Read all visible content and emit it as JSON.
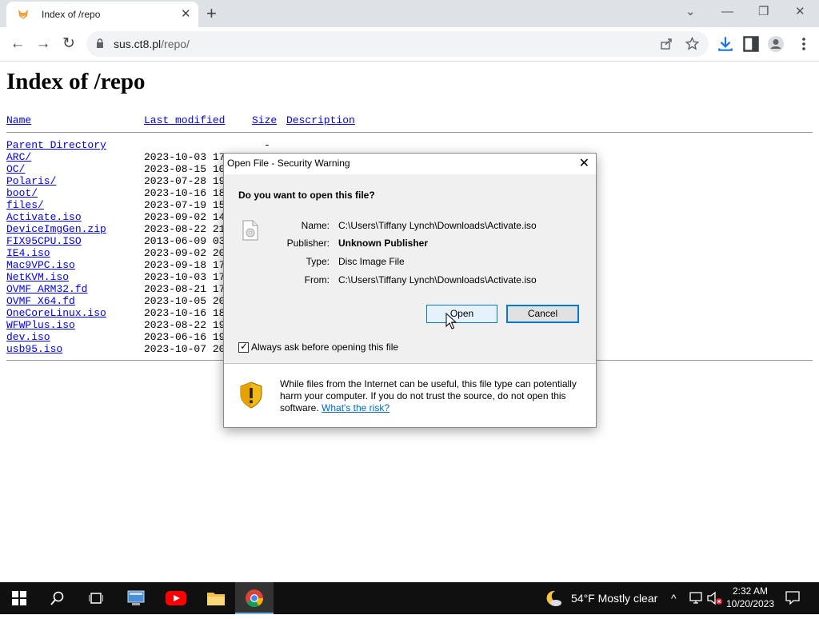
{
  "browser": {
    "tab_title": "Index of /repo",
    "tab_close": "✕",
    "new_tab": "+",
    "url_host": "sus.ct8.pl",
    "url_path": "/repo/",
    "win_dropdown": "⌄",
    "win_minimize": "—",
    "win_restore": "❐",
    "win_close": "✕",
    "back": "←",
    "forward": "→",
    "reload": "↻"
  },
  "page": {
    "heading": "Index of /repo",
    "headers": {
      "name": "Name",
      "last_modified": "Last modified",
      "size": "Size",
      "description": "Description"
    },
    "rows": [
      {
        "name": "Parent Directory",
        "date": "",
        "size": "-"
      },
      {
        "name": "ARC/",
        "date": "2023-10-03 17:"
      },
      {
        "name": "OC/",
        "date": "2023-08-15 10:"
      },
      {
        "name": "Polaris/",
        "date": "2023-07-28 19:"
      },
      {
        "name": "boot/",
        "date": "2023-10-16 18:"
      },
      {
        "name": "files/",
        "date": "2023-07-19 15:"
      },
      {
        "name": "Activate.iso",
        "date": "2023-09-02 14:"
      },
      {
        "name": "DeviceImgGen.zip",
        "date": "2023-08-22 21:"
      },
      {
        "name": "FIX95CPU.ISO",
        "date": "2013-06-09 03:"
      },
      {
        "name": "IE4.iso",
        "date": "2023-09-02 20:"
      },
      {
        "name": "Mac9VPC.iso",
        "date": "2023-09-18 17:"
      },
      {
        "name": "NetKVM.iso",
        "date": "2023-10-03 17:"
      },
      {
        "name": "OVMF_ARM32.fd",
        "date": "2023-08-21 17:"
      },
      {
        "name": "OVMF_X64.fd",
        "date": "2023-10-05 20:"
      },
      {
        "name": "OneCoreLinux.iso",
        "date": "2023-10-16 18:"
      },
      {
        "name": "WFWPlus.iso",
        "date": "2023-08-22 19:"
      },
      {
        "name": "dev.iso",
        "date": "2023-06-16 19:"
      },
      {
        "name": "usb95.iso",
        "date": "2023-10-07 20:"
      }
    ]
  },
  "dialog": {
    "title": "Open File - Security Warning",
    "close": "✕",
    "question": "Do you want to open this file?",
    "name_label": "Name:",
    "name_value": "C:\\Users\\Tiffany Lynch\\Downloads\\Activate.iso",
    "publisher_label": "Publisher:",
    "publisher_value": "Unknown Publisher",
    "type_label": "Type:",
    "type_value": "Disc Image File",
    "from_label": "From:",
    "from_value": "C:\\Users\\Tiffany Lynch\\Downloads\\Activate.iso",
    "open_button": "Open",
    "cancel_button": "Cancel",
    "checkbox_label": "Always ask before opening this file",
    "checkbox_mark": "✓",
    "warning_text": "While files from the Internet can be useful, this file type can potentially harm your computer. If you do not trust the source, do not open this software.",
    "warning_link": "What's the risk?"
  },
  "taskbar": {
    "weather": "54°F  Mostly clear",
    "time": "2:32 AM",
    "date": "10/20/2023",
    "chevron": "^"
  },
  "colors": {
    "link": "#0000ee",
    "accent": "#0078d7",
    "taskbar": "#101010"
  }
}
